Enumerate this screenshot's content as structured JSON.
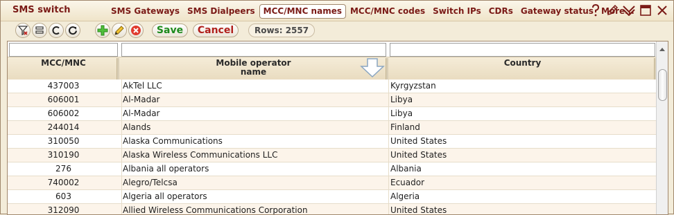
{
  "app": {
    "title": "SMS switch"
  },
  "tabs": [
    {
      "label": "SMS Gateways",
      "active": false
    },
    {
      "label": "SMS Dialpeers",
      "active": false
    },
    {
      "label": "MCC/MNC names",
      "active": true
    },
    {
      "label": "MCC/MNC codes",
      "active": false
    },
    {
      "label": "Switch IPs",
      "active": false
    },
    {
      "label": "CDRs",
      "active": false
    },
    {
      "label": "Gateway status",
      "active": false
    },
    {
      "label": "More...",
      "active": false
    }
  ],
  "window_icons": [
    "help-icon",
    "edit-pencil-icon",
    "collapse-chevron-icon",
    "maximize-icon",
    "close-icon"
  ],
  "toolbar": {
    "save_label": "Save",
    "cancel_label": "Cancel",
    "rows_label": "Rows: 2557",
    "icons": [
      "filter-clear-icon",
      "columns-icon",
      "refresh-c-icon",
      "reload-icon",
      "add-icon",
      "edit-icon",
      "delete-icon"
    ]
  },
  "grid": {
    "columns": [
      {
        "label": "MCC/MNC"
      },
      {
        "label": "Mobile operator\nname"
      },
      {
        "label": "Country"
      }
    ],
    "rows": [
      {
        "code": "437003",
        "operator": "AkTel LLC",
        "country": "Kyrgyzstan"
      },
      {
        "code": "606001",
        "operator": "Al-Madar",
        "country": "Libya"
      },
      {
        "code": "606002",
        "operator": "Al-Madar",
        "country": "Libya"
      },
      {
        "code": "244014",
        "operator": "Alands",
        "country": "Finland"
      },
      {
        "code": "310050",
        "operator": "Alaska Communications",
        "country": "United States"
      },
      {
        "code": "310190",
        "operator": "Alaska Wireless Communications LLC",
        "country": "United States"
      },
      {
        "code": "276",
        "operator": "Albania all operators",
        "country": "Albania"
      },
      {
        "code": "740002",
        "operator": "Alegro/Telcsa",
        "country": "Ecuador"
      },
      {
        "code": "603",
        "operator": "Algeria all operators",
        "country": "Algeria"
      },
      {
        "code": "312090",
        "operator": "Allied Wireless Communications Corporation",
        "country": "United States"
      }
    ]
  },
  "colors": {
    "brand": "#7a1a16",
    "save": "#1c8a1c",
    "cancel": "#b0201c",
    "background": "#f3ecd9"
  }
}
